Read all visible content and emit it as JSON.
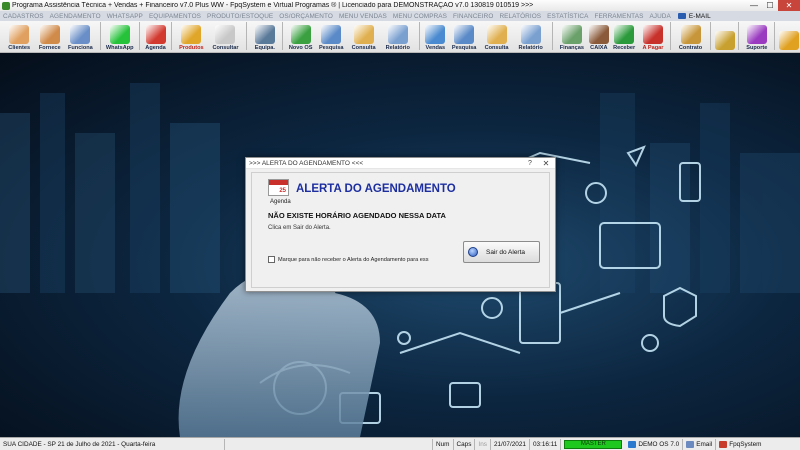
{
  "window": {
    "title": "Programa Assistência Técnica + Vendas + Financeiro v7.0 Plus WW - FpqSystem e Virtual Programas ® | Licenciado para  DEMONSTRAÇÃO v7.0 130819 010519  >>>",
    "minimize": "—",
    "maximize": "☐",
    "close": "✕"
  },
  "menu": [
    {
      "label": "CADASTROS",
      "active": false
    },
    {
      "label": "AGENDAMENTO",
      "active": false
    },
    {
      "label": "WHATSAPP",
      "active": false
    },
    {
      "label": "EQUIPAMENTOS",
      "active": false
    },
    {
      "label": "PRODUTO/ESTOQUE",
      "active": false
    },
    {
      "label": "OS/ORÇAMENTO",
      "active": false
    },
    {
      "label": "MENU VENDAS",
      "active": false
    },
    {
      "label": "MENU COMPRAS",
      "active": false
    },
    {
      "label": "FINANCEIRO",
      "active": false
    },
    {
      "label": "RELATÓRIOS",
      "active": false
    },
    {
      "label": "ESTATÍSTICA",
      "active": false
    },
    {
      "label": "FERRAMENTAS",
      "active": false
    },
    {
      "label": "AJUDA",
      "active": false
    },
    {
      "label": "E-MAIL",
      "active": true
    }
  ],
  "toolbar": [
    {
      "label": "Clientes",
      "icon": "users-icon",
      "color": "#e0a060",
      "red": false
    },
    {
      "label": "Fornece",
      "icon": "supplier-icon",
      "color": "#d08a4a",
      "red": false
    },
    {
      "label": "Funciona",
      "icon": "employee-icon",
      "color": "#6a8fc8",
      "red": false
    },
    {
      "sep": true
    },
    {
      "label": "WhatsApp",
      "icon": "whatsapp-icon",
      "color": "#25c23a",
      "red": false
    },
    {
      "sep": true
    },
    {
      "label": "Agenda",
      "icon": "calendar-icon",
      "color": "#d23a30",
      "red": false
    },
    {
      "sep": true
    },
    {
      "label": "Produtos",
      "icon": "products-icon",
      "color": "#e0a62a",
      "red": true
    },
    {
      "label": "Consultar",
      "icon": "search-products-icon",
      "color": "#c8c8c8",
      "red": false
    },
    {
      "sep": true
    },
    {
      "label": "Equipa.",
      "icon": "equipment-icon",
      "color": "#5a7a9a",
      "red": false
    },
    {
      "sep": true
    },
    {
      "label": "Novo OS",
      "icon": "new-os-icon",
      "color": "#3aa040",
      "red": false
    },
    {
      "label": "Pesquisa",
      "icon": "search-os-icon",
      "color": "#5a8ac8",
      "red": false
    },
    {
      "label": "Consulta",
      "icon": "consult-os-icon",
      "color": "#e0b050",
      "red": false
    },
    {
      "label": "Relatório",
      "icon": "report-os-icon",
      "color": "#7aa0d0",
      "red": false
    },
    {
      "sep": true
    },
    {
      "label": "Vendas",
      "icon": "sales-icon",
      "color": "#4a8ad0",
      "red": false
    },
    {
      "label": "Pesquisa",
      "icon": "search-sales-icon",
      "color": "#5a8ac8",
      "red": false
    },
    {
      "label": "Consulta",
      "icon": "consult-sales-icon",
      "color": "#e0b050",
      "red": false
    },
    {
      "label": "Relatório",
      "icon": "report-sales-icon",
      "color": "#7aa0d0",
      "red": false
    },
    {
      "sep": true
    },
    {
      "label": "Finanças",
      "icon": "finance-icon",
      "color": "#6aa06a",
      "red": false
    },
    {
      "label": "CAIXA",
      "icon": "cash-register-icon",
      "color": "#8a5a3a",
      "red": false
    },
    {
      "label": "Receber",
      "icon": "receive-icon",
      "color": "#2a9a3a",
      "red": false
    },
    {
      "label": "A Pagar",
      "icon": "pay-icon",
      "color": "#c8302a",
      "red": true
    },
    {
      "sep": true
    },
    {
      "label": "Contrato",
      "icon": "contract-icon",
      "color": "#c8963a",
      "red": false
    },
    {
      "sep": true
    },
    {
      "label": "",
      "icon": "coins-icon",
      "color": "#c8a030",
      "red": false
    },
    {
      "sep": true
    },
    {
      "label": "Suporte",
      "icon": "support-icon",
      "color": "#9a3ac0",
      "red": false
    },
    {
      "sep": true
    },
    {
      "label": "",
      "icon": "exit-icon",
      "color": "#e0a020",
      "red": false
    }
  ],
  "dialog": {
    "title": ">>> ALERTA DO AGENDAMENTO <<<",
    "help": "?",
    "close": "✕",
    "icon_number": "25",
    "icon_label": "Agenda",
    "heading": "ALERTA DO AGENDAMENTO",
    "message": "NÃO EXISTE HORÁRIO AGENDADO NESSA DATA",
    "sub": "Clica em Sair do Alerta.",
    "checkbox_label": "Marque para não receber o Alerta do Agendamento para ess",
    "exit_button": "Sair do Alerta"
  },
  "status": {
    "city": "SUA CIDADE  -  SP 21 de Julho de 2021  - Quarta-feira",
    "num": "Num",
    "caps": "Caps",
    "ins": "Ins",
    "date": "21/07/2021",
    "time": "03:16:11",
    "master": "MASTER",
    "demo": "DEMO OS 7.0",
    "email": "Email",
    "brand": "FpqSystem"
  },
  "colors": {
    "heading": "#1c2ea0",
    "master_bg": "#1ec81e",
    "close_btn": "#c7453b"
  }
}
